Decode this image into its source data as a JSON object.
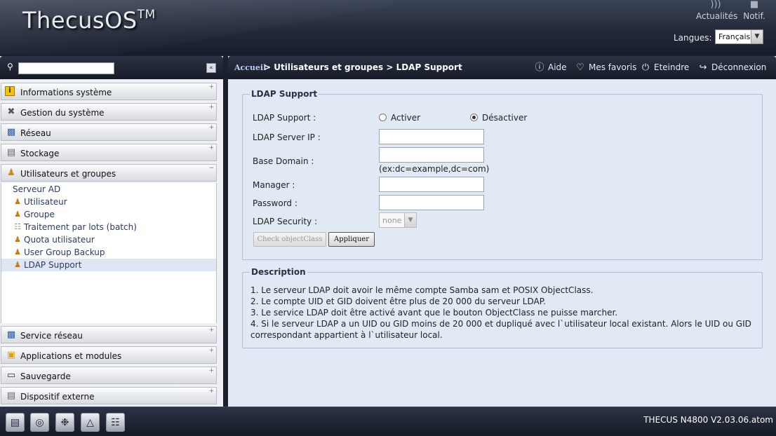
{
  "header": {
    "logo": "ThecusOS",
    "logo_tm": "TM",
    "rss_label": "Actualités",
    "notif_label": "Notif.",
    "lang_label": "Langues:",
    "lang_value": "Français"
  },
  "sidebar": {
    "search_placeholder": "",
    "categories_top": [
      {
        "label": "Informations système",
        "icon": "info-icon"
      },
      {
        "label": "Gestion du système",
        "icon": "tools-icon"
      },
      {
        "label": "Réseau",
        "icon": "network-icon"
      },
      {
        "label": "Stockage",
        "icon": "storage-icon"
      },
      {
        "label": "Utilisateurs et groupes",
        "icon": "users-icon"
      }
    ],
    "sub_items": [
      {
        "label": "Serveur AD"
      },
      {
        "label": "Utilisateur"
      },
      {
        "label": "Groupe"
      },
      {
        "label": "Traitement par lots (batch)"
      },
      {
        "label": "Quota utilisateur"
      },
      {
        "label": "User Group Backup"
      },
      {
        "label": "LDAP Support"
      }
    ],
    "categories_bottom": [
      {
        "label": "Service réseau",
        "icon": "service-icon"
      },
      {
        "label": "Applications et modules",
        "icon": "apps-icon"
      },
      {
        "label": "Sauvegarde",
        "icon": "backup-icon"
      },
      {
        "label": "Dispositif externe",
        "icon": "external-device-icon"
      }
    ]
  },
  "topbar": {
    "home": "Accueil",
    "path": "> Utilisateurs et groupes > LDAP Support",
    "help": "Aide",
    "favorites": "Mes favoris",
    "shutdown": "Eteindre",
    "logout": "Déconnexion"
  },
  "ldap": {
    "legend": "LDAP Support",
    "support_label": "LDAP Support :",
    "enable_label": "Activer",
    "disable_label": "Désactiver",
    "server_ip_label": "LDAP Server IP :",
    "server_ip_value": "",
    "base_domain_label": "Base Domain :",
    "base_domain_value": "",
    "base_domain_hint": "(ex:dc=example,dc=com)",
    "manager_label": "Manager :",
    "manager_value": "",
    "password_label": "Password :",
    "password_value": "",
    "security_label": "LDAP Security :",
    "security_value": "none",
    "check_button": "Check objectClass",
    "apply_button": "Appliquer"
  },
  "description": {
    "legend": "Description",
    "lines": [
      "1. Le serveur LDAP doit avoir le même compte Samba sam et POSIX ObjectClass.",
      "2. Le compte UID et GID doivent être plus de 20 000 du serveur LDAP.",
      "3. Le service LDAP doit être activé avant que le bouton ObjectClass ne puisse marcher.",
      "4. Si le serveur LDAP a un UID ou GID moins de 20 000 et dupliqué avec l`utilisateur local existant. Alors le UID ou GID",
      "correspondant appartient à l`utilisateur local."
    ]
  },
  "footer": {
    "version": "THECUS N4800 V2.03.06.atom",
    "icons": [
      "system-status-icon",
      "disk-icon",
      "fan-icon",
      "temperature-icon",
      "network-status-icon"
    ]
  }
}
